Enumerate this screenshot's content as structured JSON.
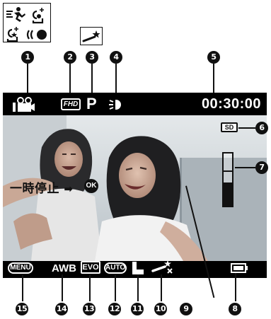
{
  "screen": {
    "time": "00:30:00",
    "record_quality": "FHD",
    "shooting_mode": "P",
    "pause_hint": "一時停止",
    "ok_label": "OK",
    "sd_label": "SD",
    "audio_level_fraction": 0.45
  },
  "bottom_bar": {
    "menu_label": "MENU",
    "awb_label": "AWB",
    "evo_label": "EVO",
    "auto_label": "AUTO"
  },
  "callouts": [
    "1",
    "2",
    "3",
    "4",
    "5",
    "6",
    "7",
    "8",
    "9",
    "10",
    "11",
    "12",
    "13",
    "14",
    "15"
  ]
}
